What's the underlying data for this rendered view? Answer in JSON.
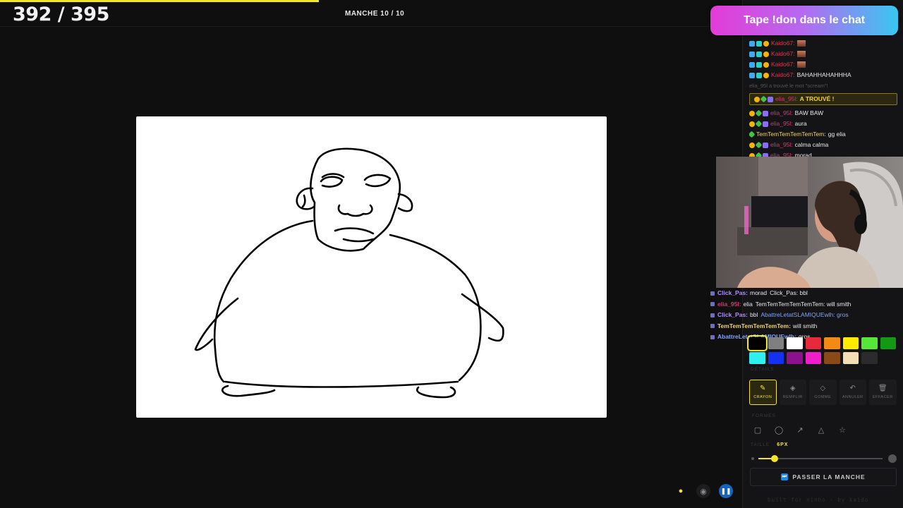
{
  "game": {
    "score": "392 / 395",
    "round": "MANCHE 10 / 10",
    "progress_pct": 43
  },
  "banner": {
    "text": "Tape !don dans le chat"
  },
  "chat": [
    {
      "user": "Kaido67:",
      "text": "",
      "user_color": "#e2334d",
      "images": true
    },
    {
      "user": "Kaido67:",
      "text": "",
      "user_color": "#e2334d",
      "images": true
    },
    {
      "user": "Kaido67:",
      "text": "",
      "user_color": "#e2334d",
      "images": true
    },
    {
      "user": "Kaido67:",
      "text": "BAHAHHAHAHHHA",
      "user_color": "#e2334d",
      "images": false
    }
  ],
  "system_line": "elia_95l a trouvé le mot \"scream\"!",
  "found": {
    "user": "elia_95l:",
    "text": "A TROUVÉ !"
  },
  "chat2": [
    {
      "user": "elia_95l:",
      "text": "BAW BAW"
    },
    {
      "user": "elia_95l:",
      "text": "aura"
    },
    {
      "user": "TemTemTemTemTemTem:",
      "text": "gg elia"
    },
    {
      "user": "elia_95l:",
      "text": "calma calma"
    },
    {
      "user": "elia_95l:",
      "text": "morad"
    }
  ],
  "overlay_chat": [
    {
      "user": "Click_Pas:",
      "text": "morad",
      "behind": "Click_Pas: bbl"
    },
    {
      "user": "elia_95l:",
      "text": "elia",
      "behind": "TemTemTemTemTemTem: will smith"
    },
    {
      "user": "Click_Pas:",
      "text": "bbl",
      "behind": "AbattreLetatSLAMIQUEwlh: gros"
    },
    {
      "user": "TemTemTemTemTemTem:",
      "text": "will smith",
      "behind": ""
    },
    {
      "user": "AbattreLetatSLAMIQUEwlh:",
      "text": "gros",
      "behind": ""
    }
  ],
  "palette": {
    "row1": [
      "#000000",
      "#7f7f7f",
      "#ffffff",
      "#e8283b",
      "#f48a16",
      "#ffea00",
      "#55e638",
      "#129a12"
    ],
    "row2": [
      "#2ff0ef",
      "#1430f0",
      "#8c118c",
      "#ef1ecb",
      "#8a4a17",
      "#f3ddb6",
      "#2b2b2b"
    ],
    "selected": "#000000"
  },
  "labels": {
    "details": "DÉTAILS",
    "forms": "FORMES",
    "size": "TAILLE",
    "size_value": "6PX"
  },
  "tools": [
    {
      "label": "CRAYON",
      "icon": "✎"
    },
    {
      "label": "REMPLIR",
      "icon": "◈"
    },
    {
      "label": "GOMME",
      "icon": "◇"
    },
    {
      "label": "ANNULER",
      "icon": "↶"
    },
    {
      "label": "EFFACER",
      "icon": "🗑"
    }
  ],
  "brush_size_fraction": 0.13,
  "pass_button": "PASSER LA MANCHE",
  "footer": "built for ninho - by kaido"
}
